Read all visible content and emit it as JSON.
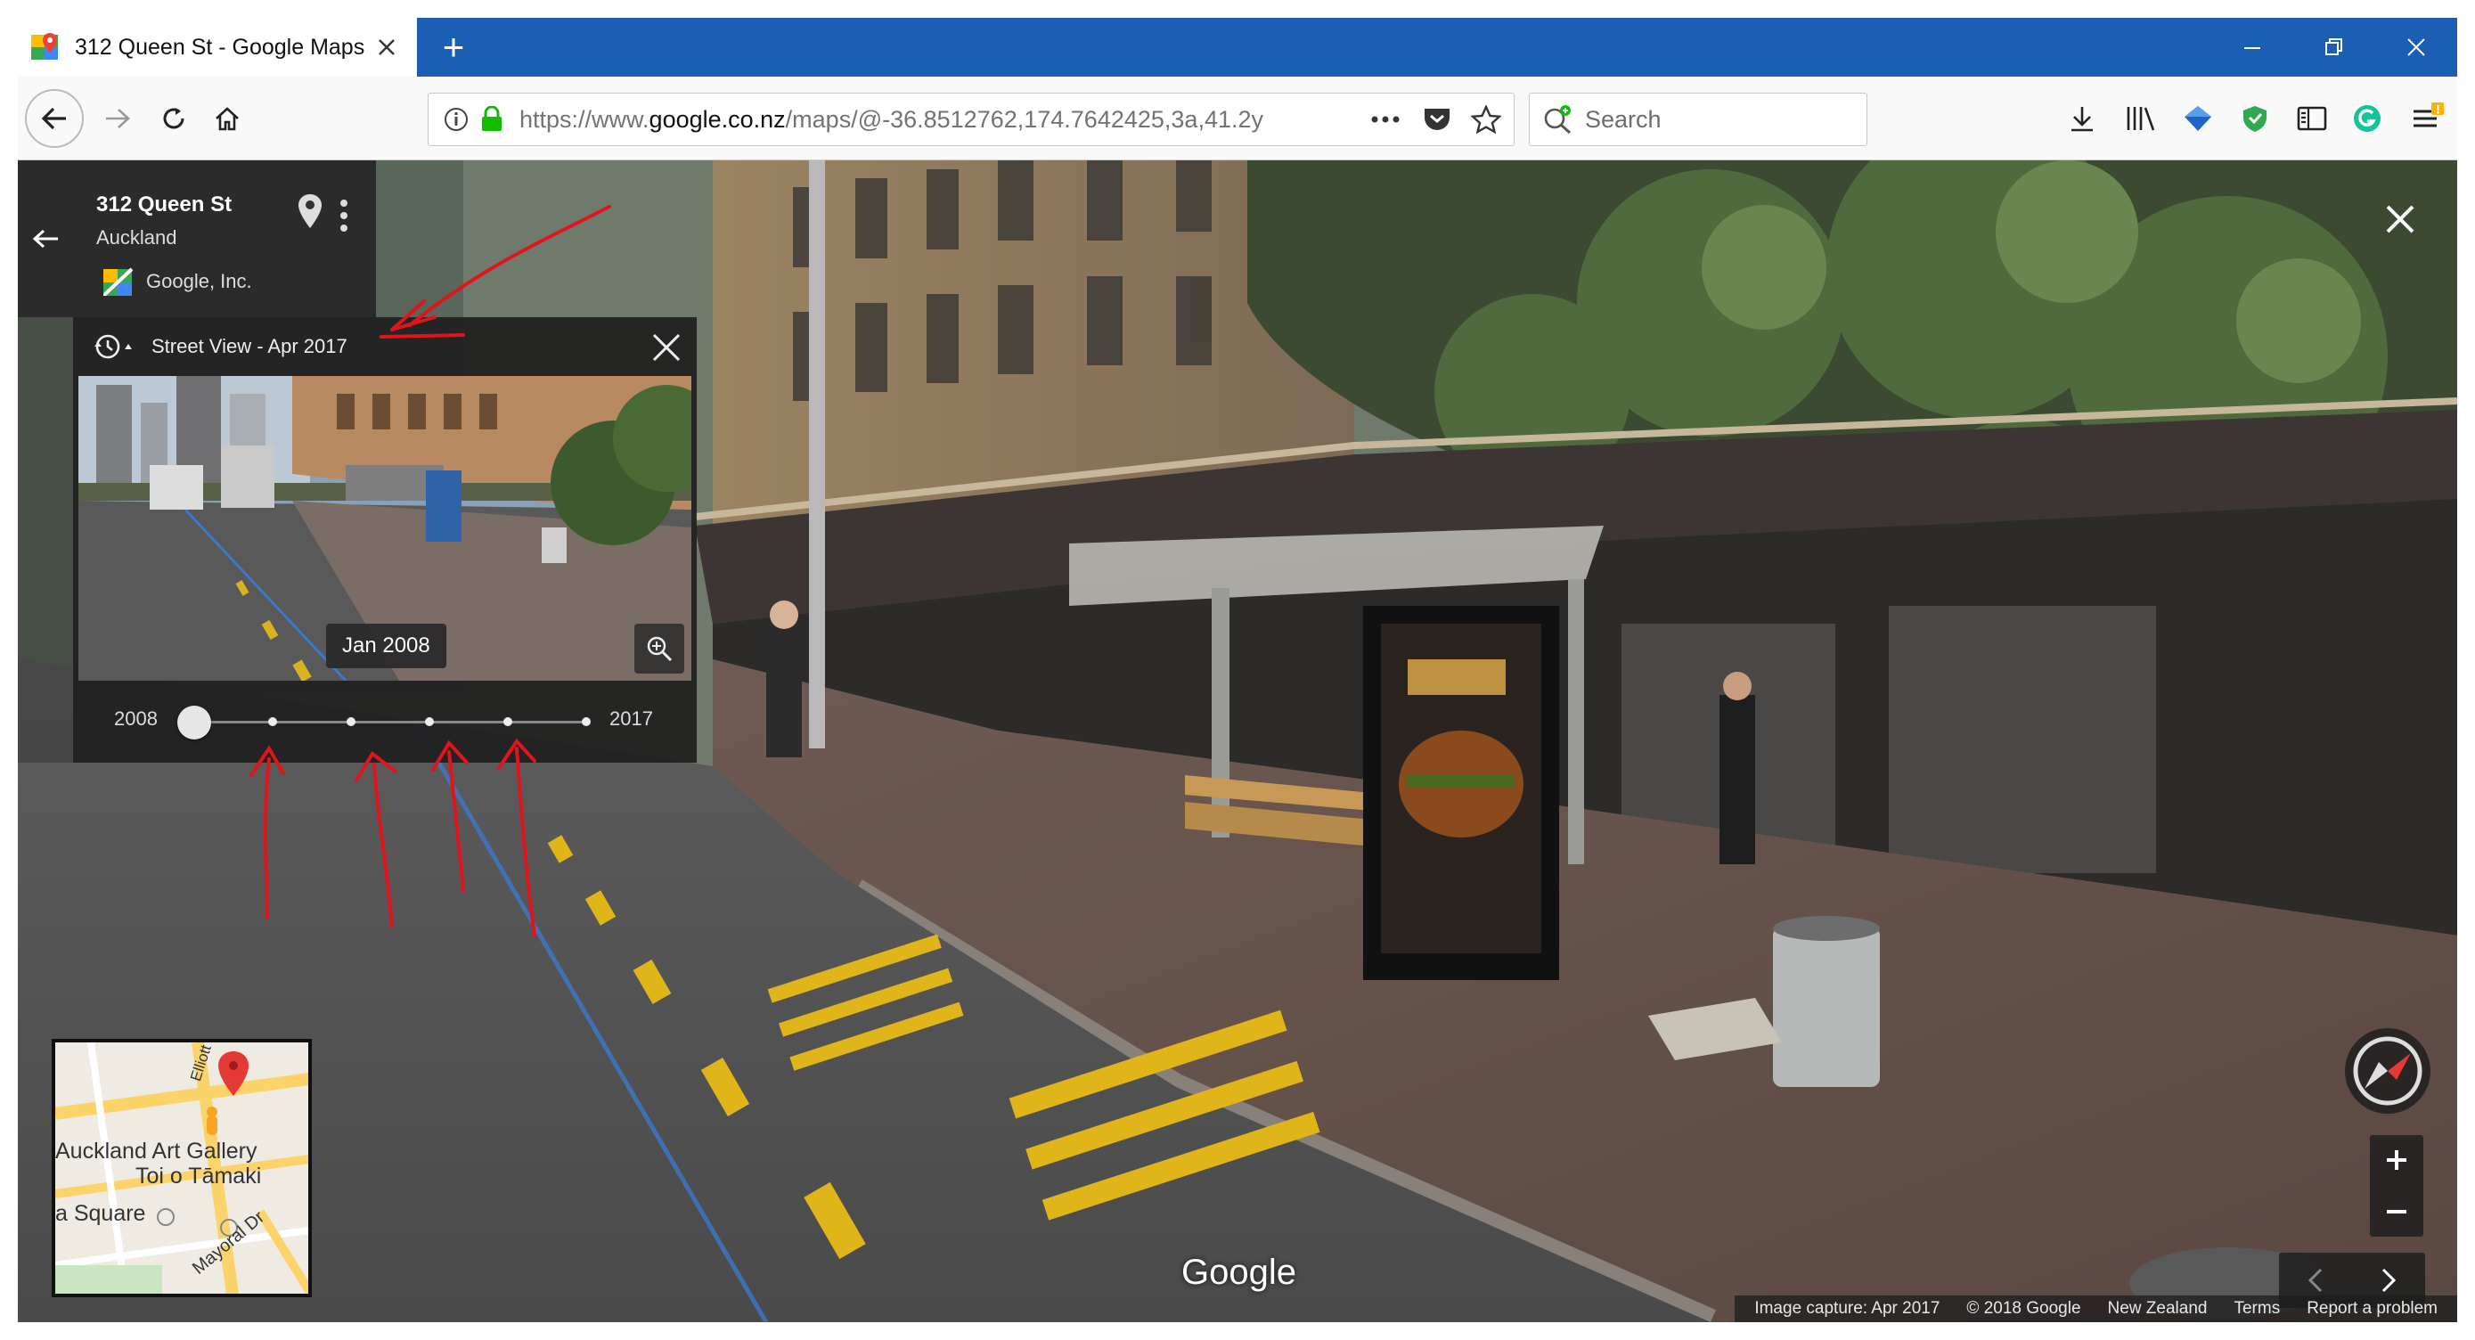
{
  "browser": {
    "tab_title": "312 Queen St - Google Maps",
    "new_tab_symbol": "+",
    "url_prefix": "https://www.",
    "url_domain": "google.co.nz",
    "url_rest": "/maps/@-36.8512762,174.7642425,3a,41.2y",
    "search_placeholder": "Search"
  },
  "place": {
    "name": "312 Queen St",
    "city": "Auckland",
    "author": "Google, Inc."
  },
  "timeline": {
    "title": "Street View - Apr 2017",
    "selected_date": "Jan 2008",
    "start_year": "2008",
    "end_year": "2017",
    "capture_count": 6,
    "selected_index": 0
  },
  "minimap": {
    "labels": [
      "Auckland Art Gallery",
      "Toi o Tāmaki",
      "a Square",
      "Elliott St",
      "Mayoral Dr"
    ]
  },
  "watermark": "Google",
  "footer": {
    "capture": "Image capture: Apr 2017",
    "copyright": "© 2018 Google",
    "region": "New Zealand",
    "terms": "Terms",
    "report": "Report a problem"
  },
  "icons": [
    "maps-favicon",
    "close-icon",
    "back-icon",
    "forward-icon",
    "reload-icon",
    "home-icon",
    "info-icon",
    "lock-icon",
    "more-icon",
    "pocket-icon",
    "star-icon",
    "search-icon",
    "download-icon",
    "library-icon",
    "bookmark-icon",
    "shield-icon",
    "sidebar-icon",
    "grammarly-icon",
    "menu-icon",
    "pin-icon",
    "kebab-icon",
    "history-icon",
    "zoom-icon",
    "compass-icon"
  ],
  "colors": {
    "tabbar": "#1a5fb4",
    "annotation": "#e0141c",
    "pin": "#e53935"
  }
}
